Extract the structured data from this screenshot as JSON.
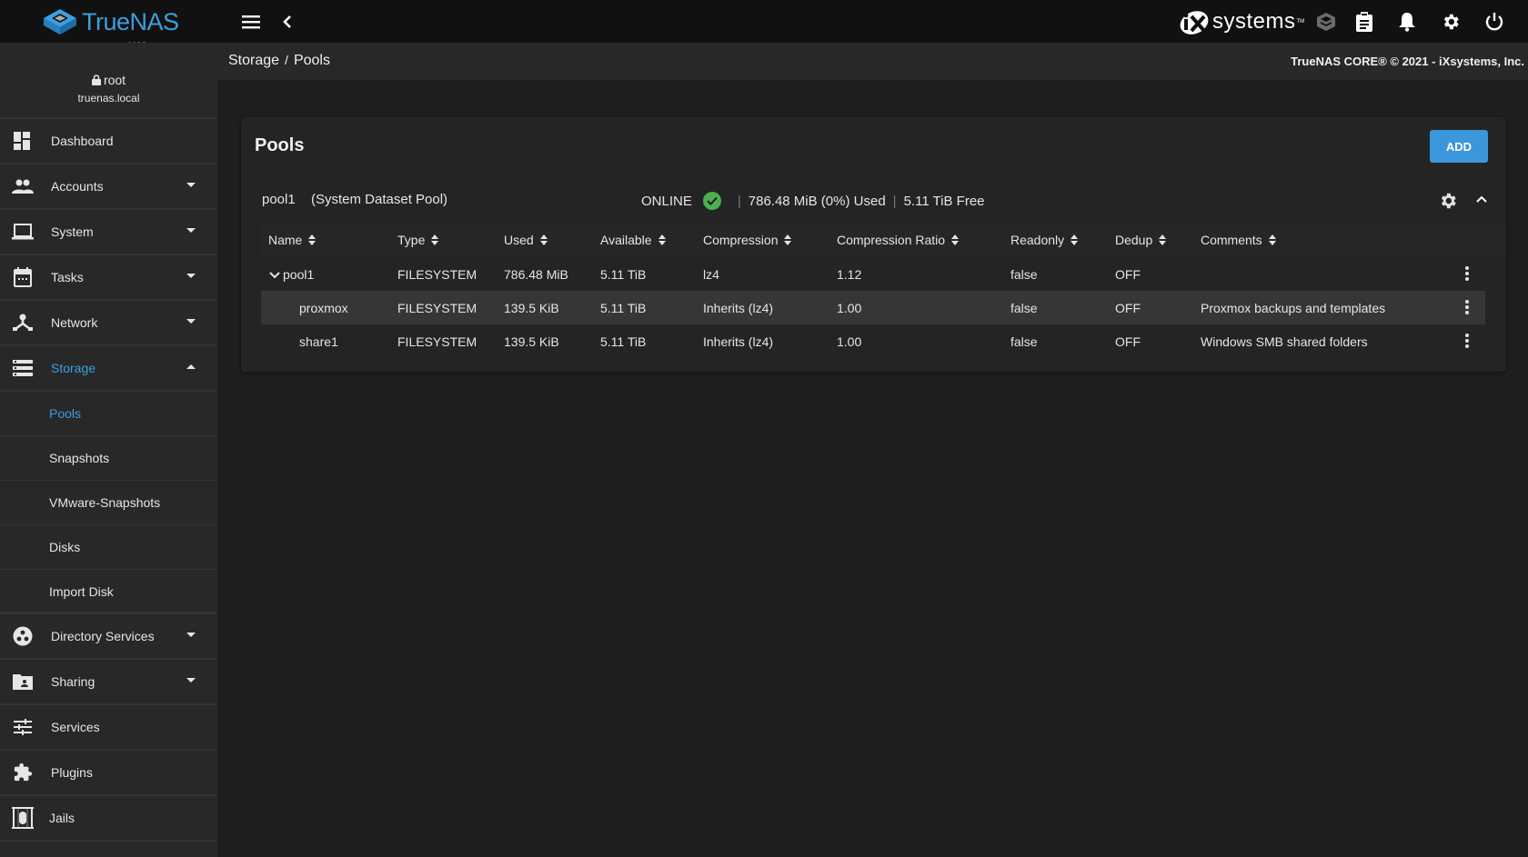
{
  "topbar": {
    "logo_text": "TrueNAS",
    "logo_sub": "CORE",
    "vendor_logo": "systems",
    "icons": [
      "menu-icon",
      "back-chevron-icon",
      "truecommand-icon",
      "clipboard-icon",
      "bell-icon",
      "gear-icon",
      "power-icon"
    ]
  },
  "user": {
    "name": "root",
    "host": "truenas.local"
  },
  "sidebar": {
    "items": [
      {
        "label": "Dashboard",
        "icon": "dashboard-icon",
        "caret": ""
      },
      {
        "label": "Accounts",
        "icon": "accounts-icon",
        "caret": "down"
      },
      {
        "label": "System",
        "icon": "laptop-icon",
        "caret": "down"
      },
      {
        "label": "Tasks",
        "icon": "calendar-icon",
        "caret": "down"
      },
      {
        "label": "Network",
        "icon": "network-icon",
        "caret": "down"
      },
      {
        "label": "Storage",
        "icon": "storage-icon",
        "caret": "up",
        "active": true
      }
    ],
    "storage_sub": [
      {
        "label": "Pools",
        "active": true
      },
      {
        "label": "Snapshots"
      },
      {
        "label": "VMware-Snapshots"
      },
      {
        "label": "Disks"
      },
      {
        "label": "Import Disk"
      }
    ],
    "items_after": [
      {
        "label": "Directory Services",
        "icon": "directory-services-icon",
        "caret": "down"
      },
      {
        "label": "Sharing",
        "icon": "sharing-folder-icon",
        "caret": "down"
      },
      {
        "label": "Services",
        "icon": "tune-icon",
        "caret": ""
      },
      {
        "label": "Plugins",
        "icon": "puzzle-icon",
        "caret": ""
      },
      {
        "label": "Jails",
        "icon": "jail-icon",
        "caret": ""
      }
    ]
  },
  "breadcrumb": {
    "parent": "Storage",
    "separator": "/",
    "current": "Pools"
  },
  "copyright": "TrueNAS CORE® © 2021 - iXsystems, Inc.",
  "card": {
    "title": "Pools",
    "add_label": "ADD",
    "pool": {
      "name": "pool1",
      "type": "(System Dataset Pool)",
      "status": "ONLINE",
      "used": "786.48 MiB (0%) Used",
      "free": "5.11 TiB Free"
    },
    "columns": [
      "Name",
      "Type",
      "Used",
      "Available",
      "Compression",
      "Compression Ratio",
      "Readonly",
      "Dedup",
      "Comments"
    ],
    "rows": [
      {
        "name": "pool1",
        "type": "FILESYSTEM",
        "used": "786.48 MiB",
        "available": "5.11 TiB",
        "compression": "lz4",
        "ratio": "1.12",
        "readonly": "false",
        "dedup": "OFF",
        "comments": ""
      },
      {
        "name": "proxmox",
        "type": "FILESYSTEM",
        "used": "139.5 KiB",
        "available": "5.11 TiB",
        "compression": "Inherits (lz4)",
        "ratio": "1.00",
        "readonly": "false",
        "dedup": "OFF",
        "comments": "Proxmox backups and templates"
      },
      {
        "name": "share1",
        "type": "FILESYSTEM",
        "used": "139.5 KiB",
        "available": "5.11 TiB",
        "compression": "Inherits (lz4)",
        "ratio": "1.00",
        "readonly": "false",
        "dedup": "OFF",
        "comments": "Windows SMB shared folders"
      }
    ]
  },
  "colors": {
    "accent": "#3b9fe0",
    "button": "#3b97db",
    "online": "#4caf50",
    "topbar": "#111111",
    "sidebar": "#282828",
    "card": "#242424"
  }
}
